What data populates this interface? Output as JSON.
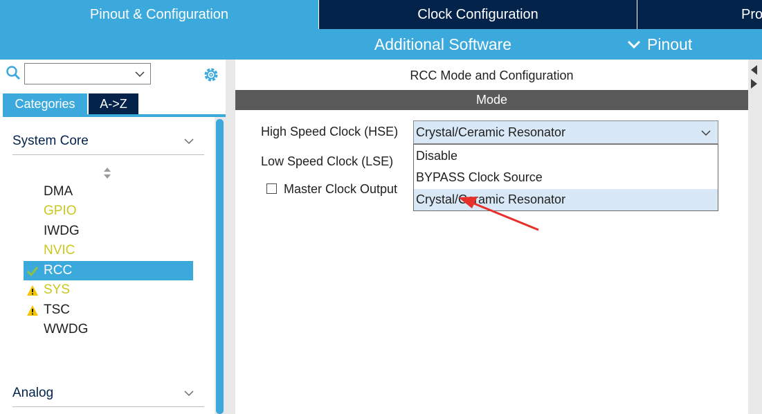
{
  "tabs": {
    "pinout": "Pinout & Configuration",
    "clock": "Clock Configuration",
    "project": "Pro"
  },
  "subbar": {
    "additional_software": "Additional Software",
    "pinout_menu": "Pinout"
  },
  "left": {
    "search": {
      "value": ""
    },
    "tab_categories": "Categories",
    "tab_az": "A->Z",
    "sections": {
      "system_core": "System Core",
      "analog": "Analog"
    },
    "items": [
      {
        "label": "DMA",
        "status": "none"
      },
      {
        "label": "GPIO",
        "status": "none"
      },
      {
        "label": "IWDG",
        "status": "none"
      },
      {
        "label": "NVIC",
        "status": "none"
      },
      {
        "label": "RCC",
        "status": "check"
      },
      {
        "label": "SYS",
        "status": "warning"
      },
      {
        "label": "TSC",
        "status": "warning"
      },
      {
        "label": "WWDG",
        "status": "none"
      }
    ]
  },
  "right": {
    "title": "RCC Mode and Configuration",
    "mode_header": "Mode",
    "hse_label": "High Speed Clock (HSE)",
    "hse_value": "Crystal/Ceramic Resonator",
    "lse_label": "Low Speed Clock (LSE)",
    "mco_label": "Master Clock Output",
    "mco_checked": false,
    "hse_options": [
      "Disable",
      "BYPASS Clock Source",
      "Crystal/Ceramic Resonator"
    ]
  },
  "colors": {
    "accent_blue": "#3ca9dc",
    "navy": "#03234b",
    "selection": "#d9e8f7",
    "warning": "#f5c400",
    "check": "#8bc34a",
    "annotation_arrow": "#e8302a"
  }
}
